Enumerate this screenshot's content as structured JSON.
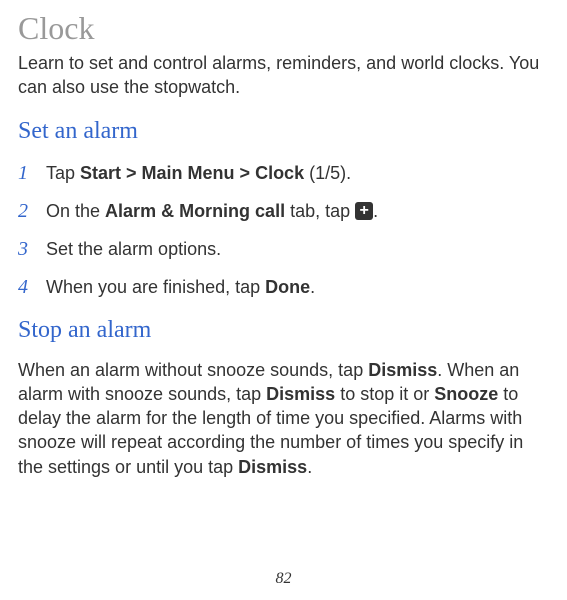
{
  "title": "Clock",
  "intro": "Learn to set and control alarms, reminders, and world clocks. You can also use the stopwatch.",
  "section1": {
    "heading": "Set an alarm",
    "steps": {
      "s1": {
        "num": "1",
        "pre": "Tap ",
        "bold": "Start > Main Menu > Clock",
        "post": " (1/5)."
      },
      "s2": {
        "num": "2",
        "pre": "On the ",
        "bold": "Alarm & Morning call",
        "mid": " tab, tap ",
        "post": "."
      },
      "s3": {
        "num": "3",
        "text": "Set the alarm options."
      },
      "s4": {
        "num": "4",
        "pre": "When you are finished, tap ",
        "bold": "Done",
        "post": "."
      }
    }
  },
  "section2": {
    "heading": "Stop an alarm",
    "body": {
      "p1": "When an alarm without snooze sounds, tap ",
      "b1": "Dismiss",
      "p2": ". When an alarm with snooze sounds, tap ",
      "b2": "Dismiss",
      "p3": " to stop it or ",
      "b3": "Snooze",
      "p4": " to delay the alarm for the length of time you specified. Alarms with snooze will repeat according the number of times you specify in the settings or until you tap ",
      "b4": "Dismiss",
      "p5": "."
    }
  },
  "page_number": "82"
}
